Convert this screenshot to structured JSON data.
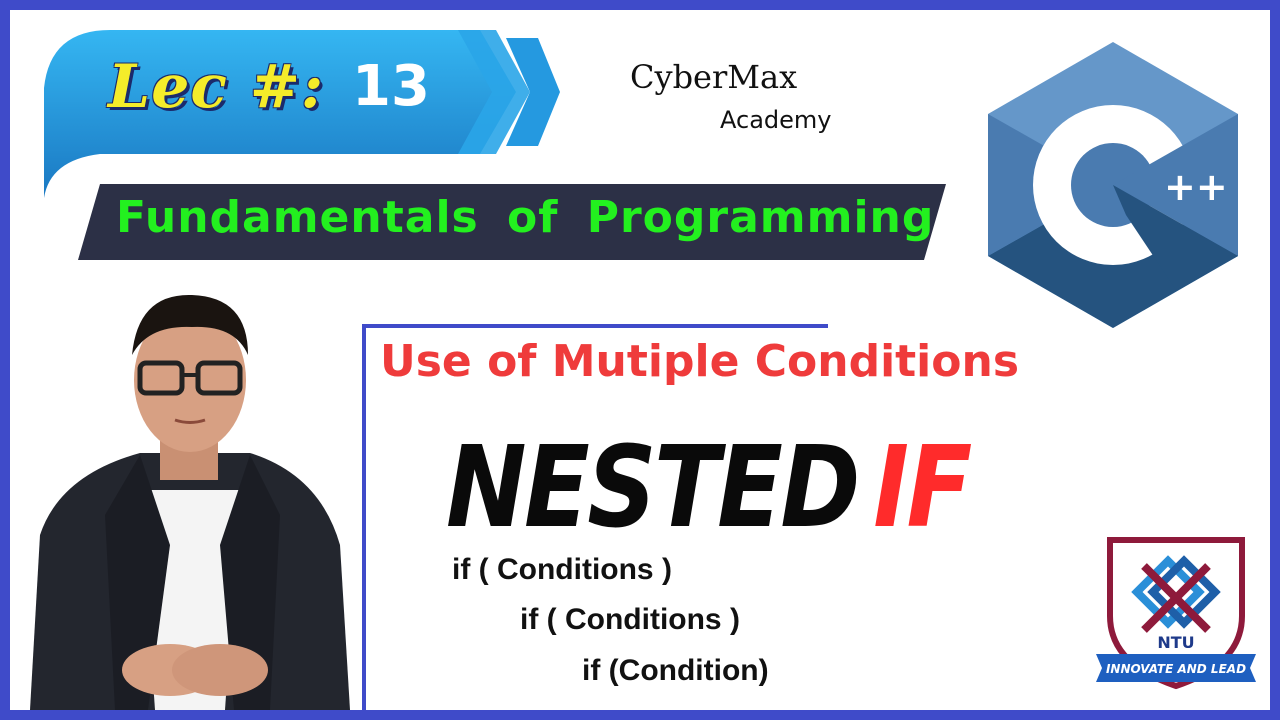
{
  "lecture": {
    "label": "Lec #:",
    "number": "13"
  },
  "course": {
    "title": "Fundamentals  of  Programming"
  },
  "brand": {
    "name": "CyberMax",
    "sub": "Academy"
  },
  "language_logo": {
    "icon": "cpp-logo-icon",
    "text": "++"
  },
  "topic": {
    "subtitle": "Use of Mutiple Conditions",
    "title_part1": "NESTED",
    "title_part2": "IF"
  },
  "code_lines": [
    "if ( Conditions )",
    "if ( Conditions )",
    "if (Condition)"
  ],
  "university": {
    "abbr": "NTU",
    "motto": "INNOVATE AND LEAD"
  },
  "colors": {
    "frame": "#3f4bc9",
    "ribbon": "#1e8fd6",
    "banner": "#2c3046",
    "banner_text": "#23f01f",
    "lec_text": "#f5ec2a",
    "subtitle": "#ef3b3b",
    "if_text": "#ff2b2b"
  }
}
